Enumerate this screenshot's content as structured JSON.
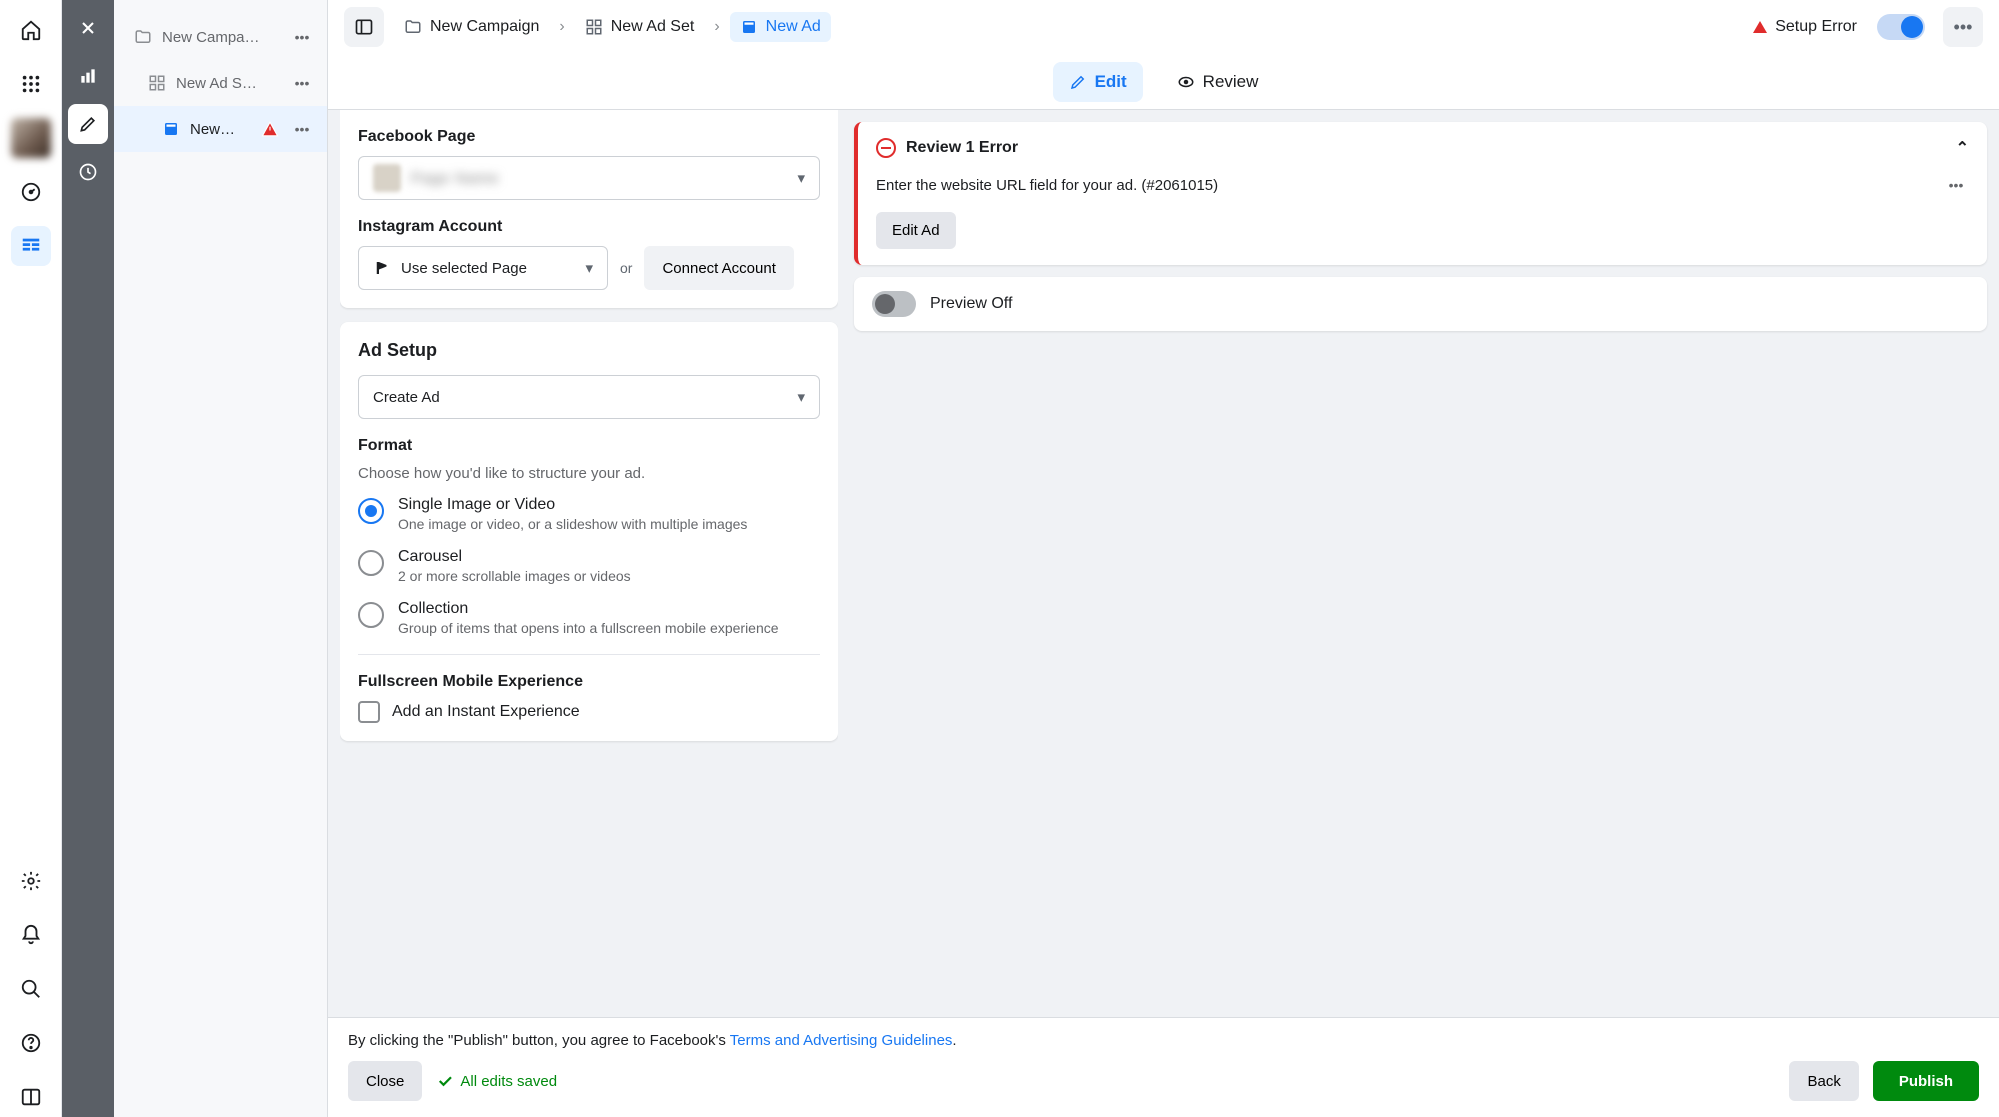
{
  "leftRail": {
    "home": "home-icon",
    "grid": "apps-icon",
    "gauge": "dashboard-icon",
    "table": "ads-manager-icon",
    "settings": "settings-icon",
    "bell": "notifications-icon",
    "search": "search-icon",
    "help": "help-icon",
    "report": "report-icon"
  },
  "rail2": {
    "close": "close-icon",
    "chart": "chart-icon",
    "edit": "edit-icon",
    "history": "history-icon"
  },
  "tree": {
    "campaign": "New Campa…",
    "adset": "New Ad S…",
    "ad": "New…"
  },
  "breadcrumb": {
    "campaign": "New Campaign",
    "adset": "New Ad Set",
    "ad": "New Ad"
  },
  "topbar": {
    "setupError": "Setup Error"
  },
  "tabs": {
    "edit": "Edit",
    "review": "Review"
  },
  "identity": {
    "fbPageLabel": "Facebook Page",
    "fbPageValue": "Page Name",
    "igLabel": "Instagram Account",
    "igSelect": "Use selected Page",
    "or": "or",
    "connect": "Connect Account"
  },
  "adSetup": {
    "title": "Ad Setup",
    "mode": "Create Ad",
    "formatLabel": "Format",
    "formatDesc": "Choose how you'd like to structure your ad.",
    "formats": [
      {
        "label": "Single Image or Video",
        "desc": "One image or video, or a slideshow with multiple images"
      },
      {
        "label": "Carousel",
        "desc": "2 or more scrollable images or videos"
      },
      {
        "label": "Collection",
        "desc": "Group of items that opens into a fullscreen mobile experience"
      }
    ],
    "fullscreenLabel": "Fullscreen Mobile Experience",
    "addInstant": "Add an Instant Experience"
  },
  "errors": {
    "title": "Review 1 Error",
    "msg": "Enter the website URL field for your ad. (#2061015)",
    "editAd": "Edit Ad"
  },
  "preview": {
    "label": "Preview Off"
  },
  "footer": {
    "textA": "By clicking the \"Publish\" button, you agree to Facebook's ",
    "link": "Terms and Advertising Guidelines",
    "textB": ".",
    "close": "Close",
    "saved": "All edits saved",
    "back": "Back",
    "publish": "Publish"
  }
}
